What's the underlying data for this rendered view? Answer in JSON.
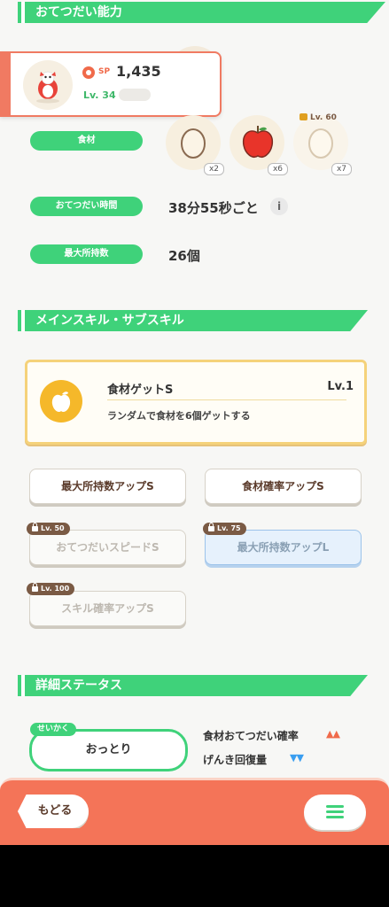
{
  "sections": {
    "ability": "おてつだい能力",
    "skills": "メインスキル・サブスキル",
    "details": "詳細ステータス"
  },
  "pokemon": {
    "sp_label": "SP",
    "sp_value": "1,435",
    "level": "Lv. 34"
  },
  "stats": {
    "ingredients_label": "食材",
    "help_time_label": "おてつだい時間",
    "help_time_value": "38分55秒ごと",
    "max_carry_label": "最大所持数",
    "max_carry_value": "26個"
  },
  "ingredients": [
    {
      "icon": "egg-icon",
      "count": "x2"
    },
    {
      "icon": "apple-icon",
      "count": "x6"
    },
    {
      "icon": "egg-icon",
      "count": "x7",
      "lock_level": "Lv. 60"
    }
  ],
  "main_skill": {
    "name": "食材ゲットS",
    "level": "Lv.1",
    "description": "ランダムで食材を6個ゲットする"
  },
  "sub_skills": [
    {
      "label": "最大所持数アップS"
    },
    {
      "label": "食材確率アップS"
    },
    {
      "label": "おてつだいスピードS",
      "lock_level": "Lv. 50"
    },
    {
      "label": "最大所持数アップL",
      "lock_level": "Lv. 75"
    },
    {
      "label": "スキル確率アップS",
      "lock_level": "Lv. 100"
    }
  ],
  "nature": {
    "tag": "せいかく",
    "value": "おっとり",
    "up_label": "食材おてつだい確率",
    "up_marks": "▲▲",
    "down_label": "げんき回復量",
    "down_marks": "▼▼"
  },
  "footer": {
    "back_label": "もどる"
  },
  "colors": {
    "green": "#3fd27a",
    "footer": "#f47458",
    "up": "#f06a4a",
    "down": "#3a9ef0"
  }
}
